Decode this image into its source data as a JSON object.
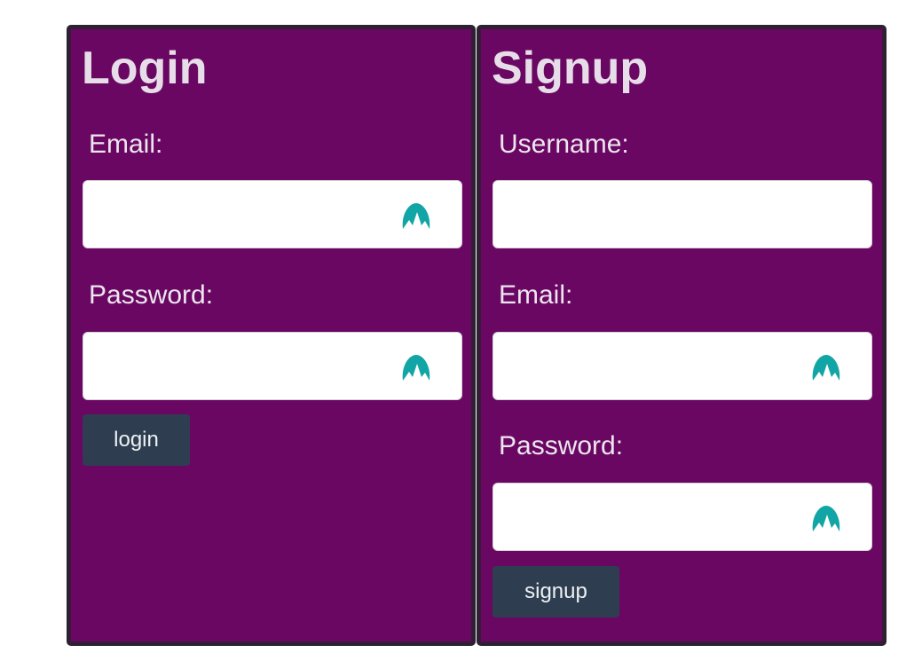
{
  "login": {
    "title": "Login",
    "email_label": "Email:",
    "email_value": "",
    "password_label": "Password:",
    "password_value": "",
    "button_label": "login"
  },
  "signup": {
    "title": "Signup",
    "username_label": "Username:",
    "username_value": "",
    "email_label": "Email:",
    "email_value": "",
    "password_label": "Password:",
    "password_value": "",
    "button_label": "signup"
  },
  "icons": {
    "field_icon": "password-manager-icon"
  },
  "colors": {
    "panel_background": "#6a0762",
    "panel_border": "#2a2230",
    "button_background": "#2e3e50",
    "icon_teal": "#12a5a5",
    "text_light": "#ece6ee"
  }
}
